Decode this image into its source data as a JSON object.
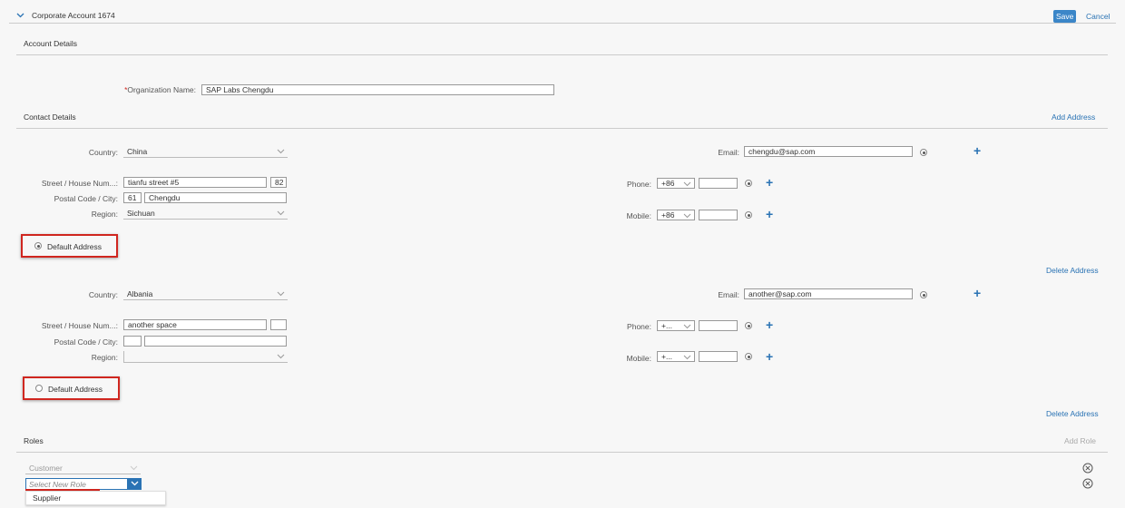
{
  "header": {
    "title": "Corporate Account 1674",
    "save_label": "Save",
    "cancel_label": "Cancel"
  },
  "account_details": {
    "section_title": "Account Details",
    "org_label": "Organization Name:",
    "org_required_mark": "*",
    "org_value": "SAP Labs Chengdu"
  },
  "contact_details": {
    "section_title": "Contact Details",
    "add_address_label": "Add Address"
  },
  "addresses": [
    {
      "country_label": "Country:",
      "country_value": "China",
      "street_label": "Street / House Num...:",
      "street_value": "tianfu street #5",
      "house_num_value": "82",
      "postal_label": "Postal Code / City:",
      "postal_value": "61",
      "city_value": "Chengdu",
      "region_label": "Region:",
      "region_value": "Sichuan",
      "email_label": "Email:",
      "email_value": "chengdu@sap.com",
      "phone_label": "Phone:",
      "phone_code": "+86",
      "mobile_label": "Mobile:",
      "mobile_code": "+86",
      "default_label": "Default Address",
      "is_default": true
    },
    {
      "delete_label": "Delete Address",
      "country_label": "Country:",
      "country_value": "Albania",
      "street_label": "Street / House Num...:",
      "street_value": "another space",
      "house_num_value": "",
      "postal_label": "Postal Code / City:",
      "postal_value": "",
      "city_value": "",
      "region_label": "Region:",
      "region_value": "",
      "email_label": "Email:",
      "email_value": "another@sap.com",
      "phone_label": "Phone:",
      "phone_code": "+...",
      "mobile_label": "Mobile:",
      "mobile_code": "+...",
      "default_label": "Default Address",
      "is_default": false
    }
  ],
  "delete_address_2_label": "Delete Address",
  "roles": {
    "section_title": "Roles",
    "add_role_label": "Add Role",
    "existing_role": "Customer",
    "new_role_placeholder": "Select New Role",
    "dropdown_options": [
      "Supplier"
    ]
  },
  "colors": {
    "accent": "#2a73b4",
    "save_button": "#3b86c8",
    "highlight": "#d0261f"
  }
}
